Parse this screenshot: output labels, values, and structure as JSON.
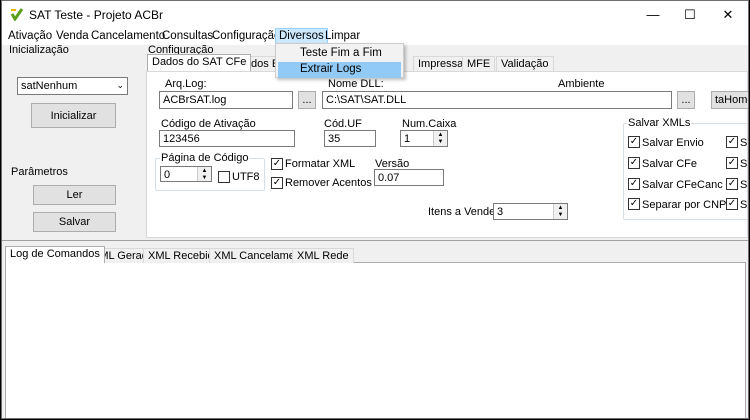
{
  "window": {
    "title": "SAT Teste - Projeto ACBr"
  },
  "menu": {
    "items": [
      "Ativação",
      "Venda",
      "Cancelamento",
      "Consultas",
      "Configuração",
      "Diversos",
      "Limpar"
    ],
    "dropdown": [
      "Teste Fim a Fim",
      "Extrair Logs"
    ]
  },
  "inicializacao": {
    "group_label": "Inicialização",
    "select_value": "satNenhum",
    "button": "Inicializar"
  },
  "parametros": {
    "group_label": "Parâmetros",
    "ler": "Ler",
    "salvar": "Salvar"
  },
  "configuracao": {
    "group_label": "Configuração",
    "tabs": [
      "Dados do SAT CFe",
      "Dados Em",
      "Impressao",
      "MFE",
      "Validação"
    ],
    "arq_log_label": "Arq.Log:",
    "arq_log_value": "ACBrSAT.log",
    "browse": "...",
    "nome_dll_label": "Nome DLL:",
    "nome_dll_value": "C:\\SAT\\SAT.DLL",
    "ambiente_label": "Ambiente",
    "ambiente_value": "taHomo",
    "codigo_ativacao_label": "Código de Ativação",
    "codigo_ativacao_value": "123456",
    "cod_uf_label": "Cód.UF",
    "cod_uf_value": "35",
    "num_caixa_label": "Num.Caixa",
    "num_caixa_value": "1",
    "pagina_codigo_label": "Página de Código",
    "pagina_codigo_value": "0",
    "utf8_label": "UTF8",
    "formatar_xml": "Formatar XML",
    "remover_acentos": "Remover Acentos",
    "versao_label": "Versão",
    "versao_value": "0.07",
    "itens_vender_label": "Itens a Vender:",
    "itens_vender_value": "3",
    "salvar_xmls_label": "Salvar XMLs",
    "salvar_envio": "Salvar Envio",
    "salvar_cfe": "Salvar CFe",
    "salvar_cfecanc": "Salvar CFeCanc",
    "separar_cnpj": "Separar por CNPJ",
    "s_col": "S"
  },
  "bottom_tabs": [
    "Log de Comandos",
    "XML Gerado",
    "XML Recebido",
    "XML Cancelamento",
    "XML Rede"
  ],
  "checks": {
    "formatar": true,
    "remover": true,
    "utf8": false,
    "envio": true,
    "cfe": true,
    "cfecanc": true,
    "cnpj": true
  }
}
